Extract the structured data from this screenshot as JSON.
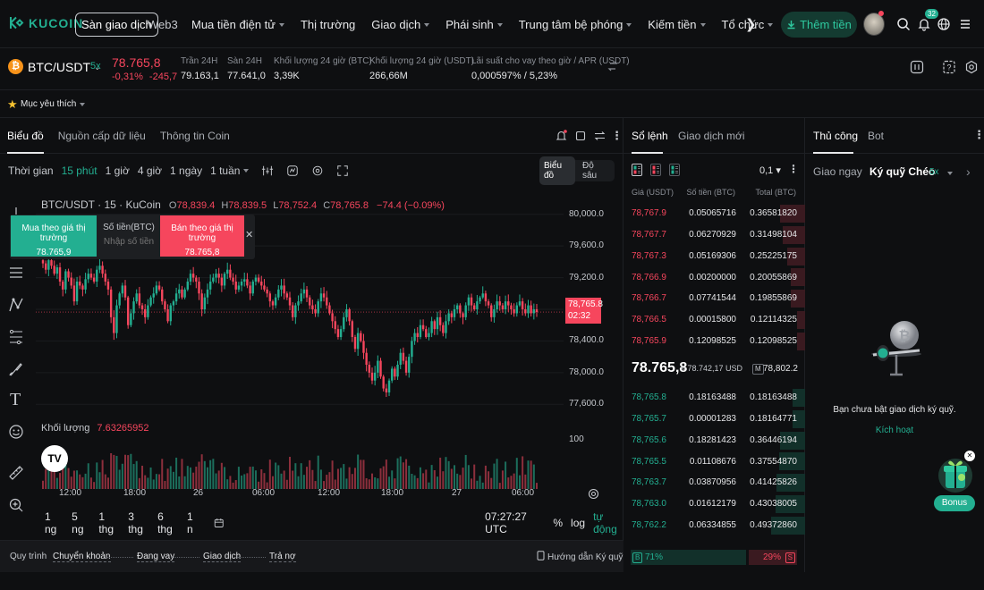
{
  "nav": {
    "brand": "KUCOIN",
    "exchange_tab": "Sàn giao dịch",
    "web3_tab": "Web3",
    "menu": [
      {
        "label": "Mua tiền điện tử",
        "caret": true
      },
      {
        "label": "Thị trường",
        "caret": false
      },
      {
        "label": "Giao dịch",
        "caret": true
      },
      {
        "label": "Phái sinh",
        "caret": true
      },
      {
        "label": "Trung tâm bệ phóng",
        "caret": true
      },
      {
        "label": "Kiếm tiền",
        "caret": true
      },
      {
        "label": "Tổ chức",
        "caret": true
      },
      {
        "label": "Xem thêm",
        "caret": true
      }
    ],
    "deposit_label": "Thêm tiền",
    "notification_count": "32"
  },
  "ticker": {
    "pair": "BTC/USDT",
    "leverage": "5x",
    "last_price": "78.765,8",
    "change_pct": "-0,31%",
    "change_abs": "-245,7",
    "stats": [
      {
        "label": "Trần 24H",
        "value": "79.163,1"
      },
      {
        "label": "Sàn 24H",
        "value": "77.641,0"
      },
      {
        "label": "Khối lượng 24 giờ (BTC)",
        "value": "3,39K"
      },
      {
        "label": "Khối lượng 24 giờ (USDT)",
        "value": "266,66M"
      },
      {
        "label": "Lãi suất cho vay theo giờ / APR (USDT)",
        "value": "0,000597% / 5,23%"
      }
    ]
  },
  "favorites": {
    "label": "Mục yêu thích"
  },
  "chart_panel": {
    "tabs": [
      "Biểu đồ",
      "Nguồn cấp dữ liệu",
      "Thông tin Coin"
    ],
    "timeframes_label": "Thời gian",
    "timeframes": [
      "15 phút",
      "1 giờ",
      "4 giờ",
      "1 ngày",
      "1 tuần"
    ],
    "active_timeframe": "15 phút",
    "view_chart": "Biểu đồ",
    "view_depth": "Độ sâu",
    "ohlc": {
      "title": "BTC/USDT · 15 · KuCoin",
      "o": "78,839.4",
      "h": "78,839.5",
      "l": "78,752.4",
      "c": "78,765.8",
      "chg": "−74.4 (−0.09%)"
    },
    "quick_trade": {
      "buy_label": "Mua theo giá thị trường",
      "buy_price": "78.765,9",
      "qty_label": "Số tiền(BTC)",
      "qty_placeholder": "Nhập số tiền",
      "sell_label": "Bán theo giá thị trường",
      "sell_price": "78.765,8"
    },
    "price_tag": {
      "price": "78,765.8",
      "countdown": "02:32"
    },
    "volume_label": "Khối lượng",
    "volume_value": "7.63265952",
    "volume_axis": "100",
    "ranges": [
      "1 ng",
      "5 ng",
      "1 thg",
      "3 thg",
      "6 thg",
      "1 n"
    ],
    "clock": "07:27:27 UTC",
    "pct": "%",
    "log": "log",
    "auto": "tự động",
    "tv_logo": "TV"
  },
  "chart_data": {
    "type": "candlestick",
    "y_ticks": [
      "80,000.0",
      "79,600.0",
      "79,200.0",
      "78,400.0",
      "78,000.0",
      "77,600.0"
    ],
    "ylim": [
      77400,
      80200
    ],
    "x_ticks": [
      "12:00",
      "18:00",
      "26",
      "06:00",
      "12:00",
      "18:00",
      "27",
      "06:00"
    ],
    "last_close": 78765.8,
    "closes": [
      79380,
      79300,
      79420,
      79350,
      79250,
      79330,
      79150,
      79050,
      79280,
      79200,
      79100,
      78900,
      79150,
      79100,
      79050,
      79180,
      79250,
      79200,
      79150,
      79300,
      79350,
      79250,
      79150,
      79050,
      78700,
      78500,
      78850,
      79000,
      79100,
      78950,
      78600,
      78750,
      78900,
      79000,
      78850,
      78800,
      78700,
      78850,
      78950,
      79000,
      79100,
      79050,
      78900,
      78800,
      78650,
      78850,
      78900,
      79000,
      79050,
      78950,
      79050,
      79150,
      79250,
      79200,
      79150,
      79000,
      78800,
      78950,
      79050,
      79150,
      79200,
      79250,
      79200,
      79100,
      79250,
      79300,
      79200,
      79150,
      79050,
      79100,
      79150,
      79180,
      79100,
      79000,
      79150,
      79200,
      79150,
      79100,
      79050,
      79000,
      78900,
      78850,
      78950,
      79050,
      79100,
      79000,
      78950,
      78850,
      78700,
      78850,
      78900,
      79000,
      79050,
      78950,
      78850,
      78800,
      78750,
      78900,
      79000,
      78950,
      78850,
      78750,
      78650,
      78550,
      78450,
      78550,
      78700,
      78800,
      78650,
      78450,
      78300,
      78500,
      78400,
      78250,
      78100,
      78000,
      77900,
      78000,
      78150,
      77950,
      77800,
      77750,
      77900,
      78050,
      77950,
      78100,
      78250,
      78150,
      78000,
      78200,
      78400,
      78500,
      78450,
      78600,
      78550,
      78450,
      78500,
      78650,
      78550,
      78700,
      78600,
      78500,
      78650,
      78750,
      78700,
      78800,
      78850,
      78750,
      78700,
      78850,
      78950,
      78850,
      78800,
      78900,
      78950,
      79000,
      78900,
      78850,
      78700,
      78800,
      78900,
      78850,
      78800,
      78900,
      78850,
      78800,
      78750,
      78850,
      78900,
      78800,
      78750,
      78850,
      78750,
      78800,
      78766
    ],
    "volume_ylim": [
      0,
      160
    ]
  },
  "bottom_bar": {
    "items": [
      "Quy trình",
      "Chuyển khoản",
      "Đang vay",
      "Giao dịch",
      "Trả nợ"
    ],
    "guide": "Hướng dẫn Ký quỹ"
  },
  "orderbook": {
    "tabs": [
      "Sổ lệnh",
      "Giao dịch mới"
    ],
    "precision": "0,1",
    "headers": [
      "Giá (USDT)",
      "Số tiền (BTC)",
      "Total (BTC)"
    ],
    "asks": [
      [
        "78,767.9",
        "0.05065716",
        "0.36581820",
        0.75
      ],
      [
        "78,767.7",
        "0.06270929",
        "0.31498104",
        0.65
      ],
      [
        "78,767.3",
        "0.05169306",
        "0.25225175",
        0.52
      ],
      [
        "78,766.9",
        "0.00200000",
        "0.20055869",
        0.41
      ],
      [
        "78,766.7",
        "0.07741544",
        "0.19855869",
        0.41
      ],
      [
        "78,766.5",
        "0.00015800",
        "0.12114325",
        0.25
      ],
      [
        "78,765.9",
        "0.12098525",
        "0.12098525",
        0.25
      ]
    ],
    "mid_price": "78.765,8",
    "mid_usd": "≈ 78.742,17 USD",
    "mark_label": "M",
    "mark_price": "78,802.2",
    "bids": [
      [
        "78,765.8",
        "0.18163488",
        "0.18163488",
        0.37
      ],
      [
        "78,765.7",
        "0.00001283",
        "0.18164771",
        0.37
      ],
      [
        "78,765.6",
        "0.18281423",
        "0.36446194",
        0.74
      ],
      [
        "78,765.5",
        "0.01108676",
        "0.37554870",
        0.77
      ],
      [
        "78,763.7",
        "0.03870956",
        "0.41425826",
        0.85
      ],
      [
        "78,763.0",
        "0.01612179",
        "0.43038005",
        0.88
      ],
      [
        "78,762.2",
        "0.06334855",
        "0.49372860",
        1.0
      ]
    ],
    "buy_ratio": "71%",
    "sell_ratio": "29%",
    "buy_ratio_value": 0.71,
    "buy_tag": "B",
    "sell_tag": "S"
  },
  "right_panel": {
    "tabs": [
      "Thủ công",
      "Bot"
    ],
    "spot_label": "Giao ngay",
    "margin_label": "Ký quỹ Chéo",
    "margin_lev": "5x",
    "empty_msg": "Bạn chưa bật giao dịch ký quỹ.",
    "activate": "Kích hoạt",
    "bonus": "Bonus"
  },
  "colors": {
    "accent": "#23af91",
    "down": "#f6465d",
    "up": "#23af91",
    "bg": "#0e0f11"
  }
}
